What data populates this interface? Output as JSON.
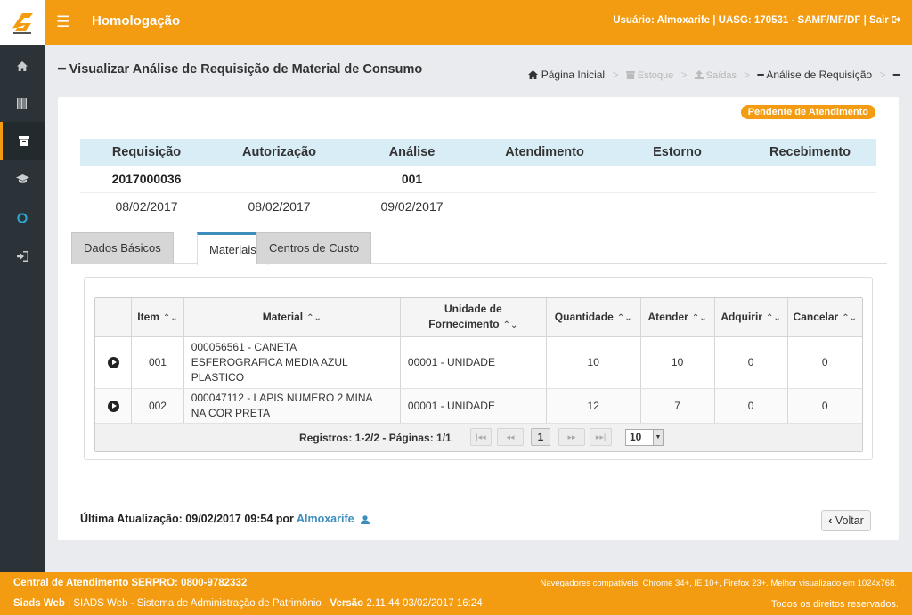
{
  "app": {
    "environment_title": "Homologação",
    "user_info": "Usuário: Almoxarife | UASG: 170531 - SAMF/MF/DF |",
    "logout_label": "Sair"
  },
  "sidebar": {
    "items": [
      {
        "icon": "home-icon"
      },
      {
        "icon": "barcode-icon"
      },
      {
        "icon": "archive-icon",
        "active": true
      },
      {
        "icon": "graduation-cap-icon"
      },
      {
        "icon": "circle-icon"
      },
      {
        "icon": "sign-in-icon"
      }
    ]
  },
  "page": {
    "title": "Visualizar Análise de Requisição de Material de Consumo",
    "breadcrumb": {
      "home": "Página Inicial",
      "estoque": "Estoque",
      "saidas": "Saídas",
      "current": "Análise de Requisição"
    },
    "status_badge": "Pendente de Atendimento"
  },
  "summary": {
    "headers": [
      "Requisição",
      "Autorização",
      "Análise",
      "Atendimento",
      "Estorno",
      "Recebimento"
    ],
    "numbers": [
      "2017000036",
      "",
      "001",
      "",
      "",
      ""
    ],
    "dates": [
      "08/02/2017",
      "08/02/2017",
      "09/02/2017",
      "",
      "",
      ""
    ]
  },
  "tabs": [
    {
      "label": "Dados Básicos",
      "active": false
    },
    {
      "label": "Materiais",
      "active": true
    },
    {
      "label": "Centros de Custo",
      "active": false
    }
  ],
  "grid": {
    "columns": {
      "item": "Item",
      "material": "Material",
      "unidade_line1": "Unidade de",
      "unidade_line2": "Fornecimento",
      "quantidade": "Quantidade",
      "atender": "Atender",
      "adquirir": "Adquirir",
      "cancelar": "Cancelar"
    },
    "rows": [
      {
        "item": "001",
        "material_l1": "000056561 - CANETA",
        "material_l2": "ESFEROGRAFICA MEDIA AZUL",
        "material_l3": "PLASTICO",
        "unidade": "00001 - UNIDADE",
        "quantidade": "10",
        "atender": "10",
        "adquirir": "0",
        "cancelar": "0"
      },
      {
        "item": "002",
        "material_l1": "000047112 - LAPIS NUMERO 2 MINA",
        "material_l2": "NA COR PRETA",
        "unidade": "00001 - UNIDADE",
        "quantidade": "12",
        "atender": "7",
        "adquirir": "0",
        "cancelar": "0"
      }
    ],
    "pager": {
      "info": "Registros: 1-2/2 - Páginas: 1/1",
      "current_page": "1",
      "page_size": "10"
    }
  },
  "footer_panel": {
    "last_update_label": "Última Atualização: 09/02/2017 09:54 por",
    "last_update_user": "Almoxarife",
    "back_label": "Voltar"
  },
  "footer": {
    "support": "Central de Atendimento SERPRO: 0800-9782332",
    "browsers": "Navegadores compatíveis: Chrome 34+, IE 10+, Firefox 23+. Melhor visualizado em 1024x768.",
    "app_short": "Siads Web",
    "app_long": "| SIADS Web - Sistema de Administração de Patrimônio",
    "version_label": "Versão",
    "version_value": "2.11.44 03/02/2017 16:24",
    "rights": "Todos os direitos reservados."
  },
  "colors": {
    "brand_orange": "#f39c12",
    "sidebar": "#2b3338",
    "accent_blue": "#3c8dbc",
    "header_blue": "#d9edf7"
  }
}
